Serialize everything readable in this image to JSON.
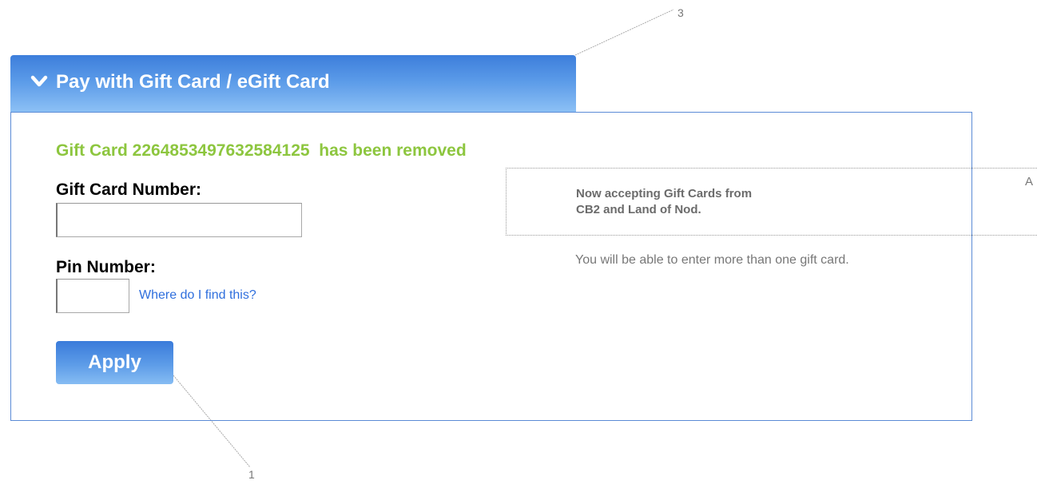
{
  "annotations": {
    "callout_3": "3",
    "callout_1": "1",
    "callout_a": "A"
  },
  "header": {
    "icon": "chevron-down-icon",
    "title": "Pay with Gift Card / eGift Card",
    "background_color": "#4a8ce2"
  },
  "message": {
    "removed": "Gift Card 2264853497632584125  has been removed",
    "color": "#8dc63f"
  },
  "form": {
    "card_number_label": "Gift Card Number:",
    "card_number_value": "",
    "pin_label": "Pin Number:",
    "pin_value": "",
    "help_link": "Where do I find this?",
    "apply_label": "Apply"
  },
  "notice": {
    "line1": "Now accepting Gift Cards from",
    "line2": "CB2 and Land of Nod.",
    "info": "You will be able to enter more than one gift card."
  }
}
